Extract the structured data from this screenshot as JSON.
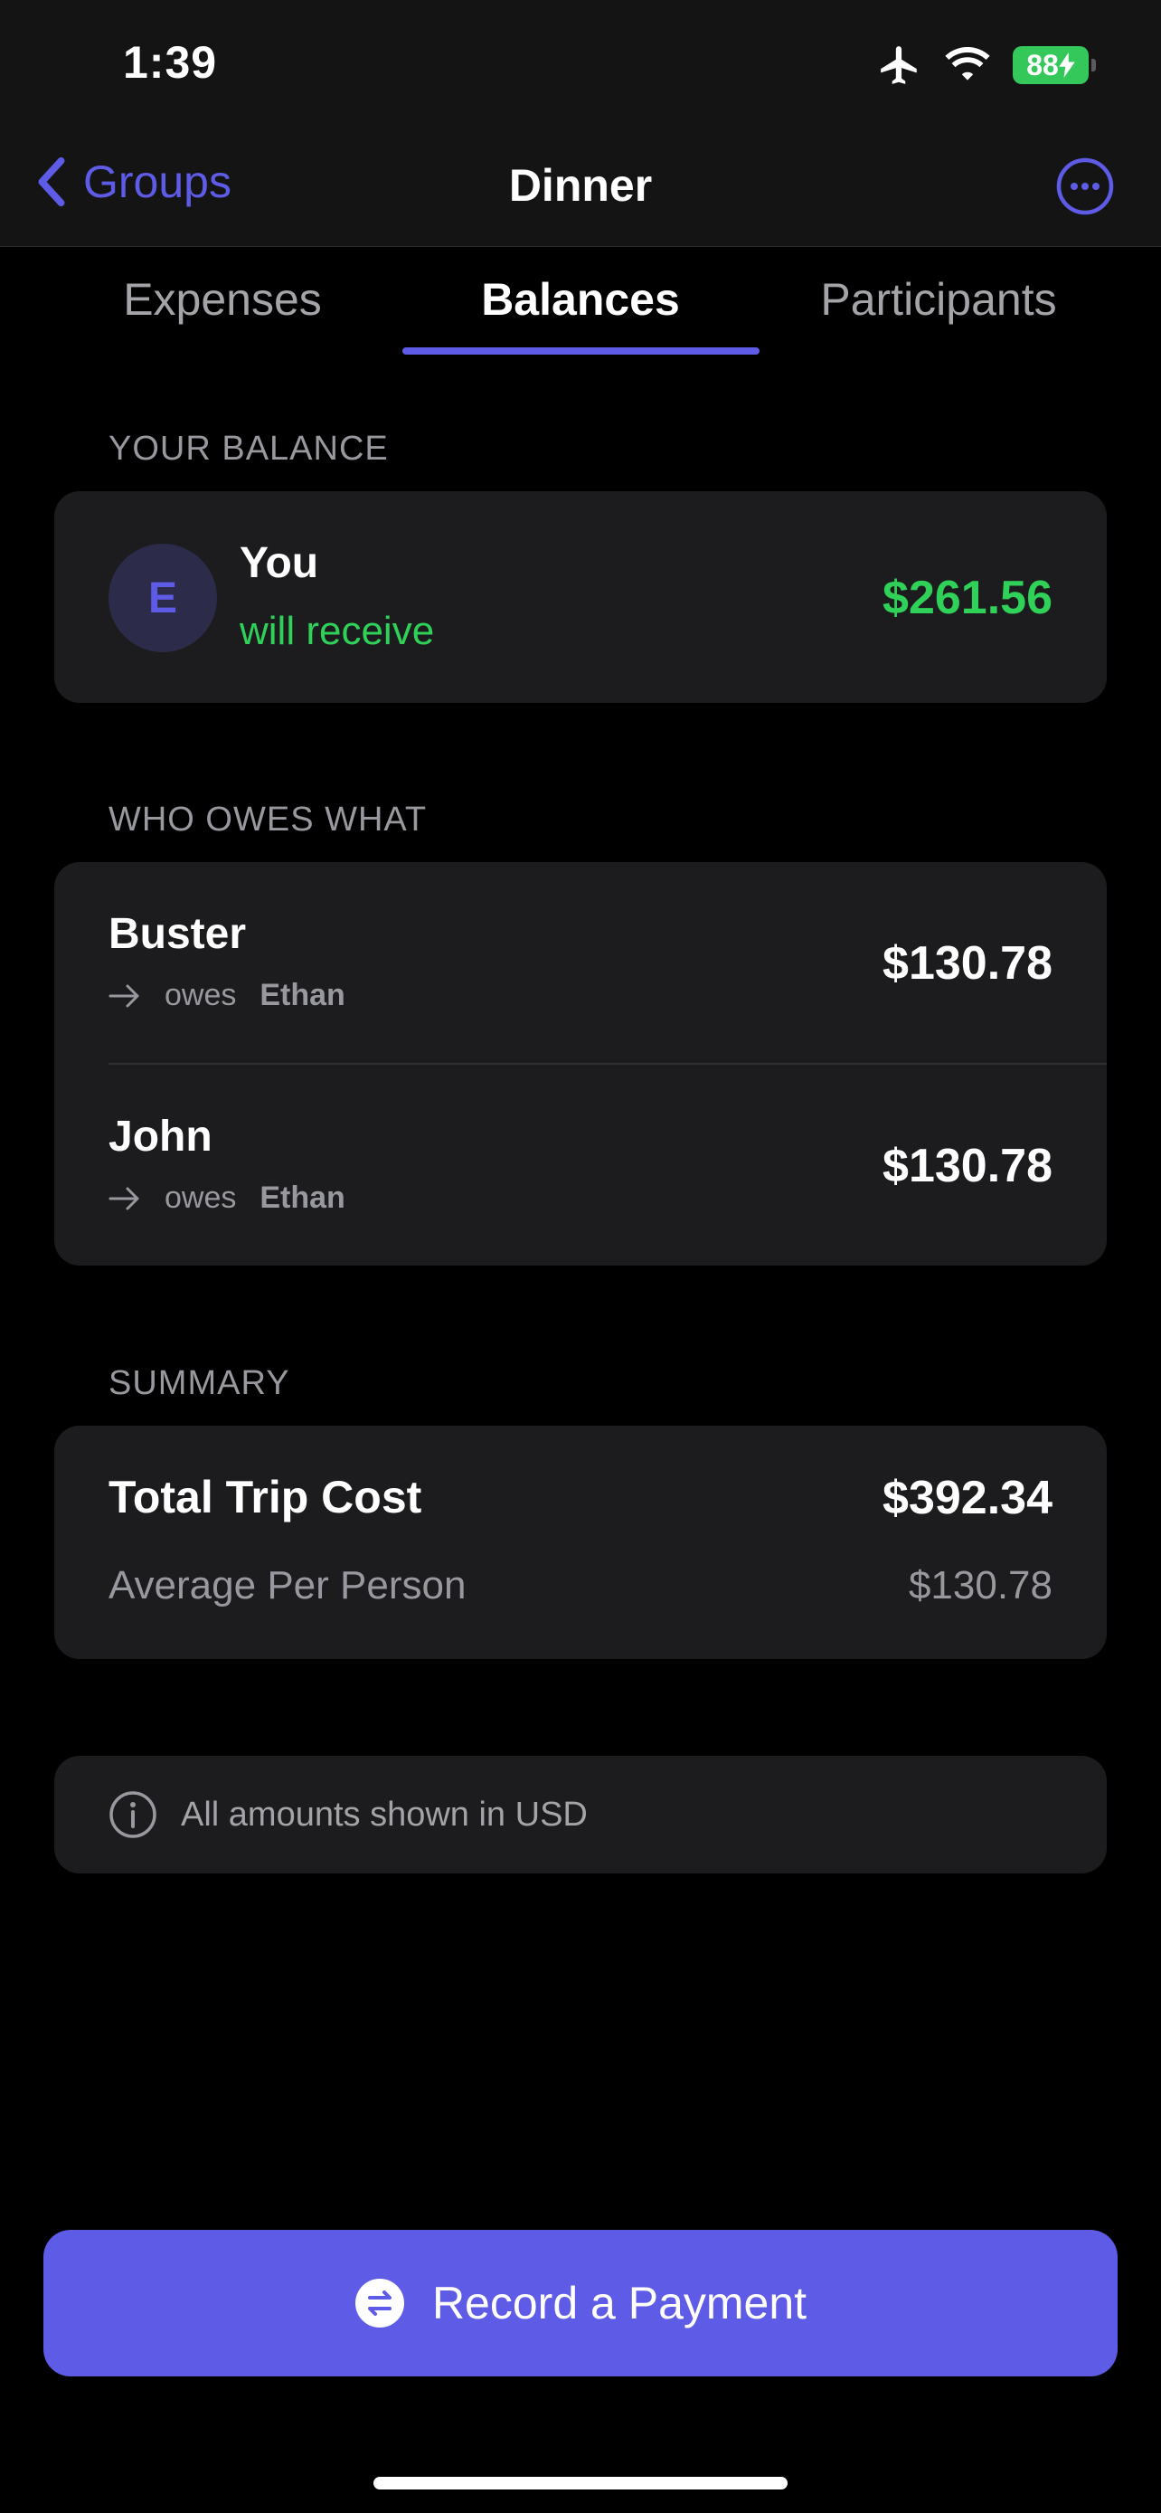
{
  "status_bar": {
    "time": "1:39",
    "battery": "88"
  },
  "nav": {
    "back_label": "Groups",
    "title": "Dinner"
  },
  "tabs": [
    {
      "label": "Expenses",
      "active": false
    },
    {
      "label": "Balances",
      "active": true
    },
    {
      "label": "Participants",
      "active": false
    }
  ],
  "your_balance": {
    "header": "YOUR BALANCE",
    "avatar_initial": "E",
    "name": "You",
    "status": "will receive",
    "amount": "$261.56"
  },
  "who_owes": {
    "header": "WHO OWES WHAT",
    "rows": [
      {
        "name": "Buster",
        "verb": "owes",
        "to": "Ethan",
        "amount": "$130.78"
      },
      {
        "name": "John",
        "verb": "owes",
        "to": "Ethan",
        "amount": "$130.78"
      }
    ]
  },
  "summary": {
    "header": "SUMMARY",
    "total_label": "Total Trip Cost",
    "total_value": "$392.34",
    "average_label": "Average Per Person",
    "average_value": "$130.78"
  },
  "info": {
    "text": "All amounts shown in USD"
  },
  "actions": {
    "record_payment": "Record a Payment"
  },
  "colors": {
    "accent": "#5e5ce6",
    "positive": "#30d158",
    "card": "#1c1c1e",
    "background": "#000000"
  }
}
